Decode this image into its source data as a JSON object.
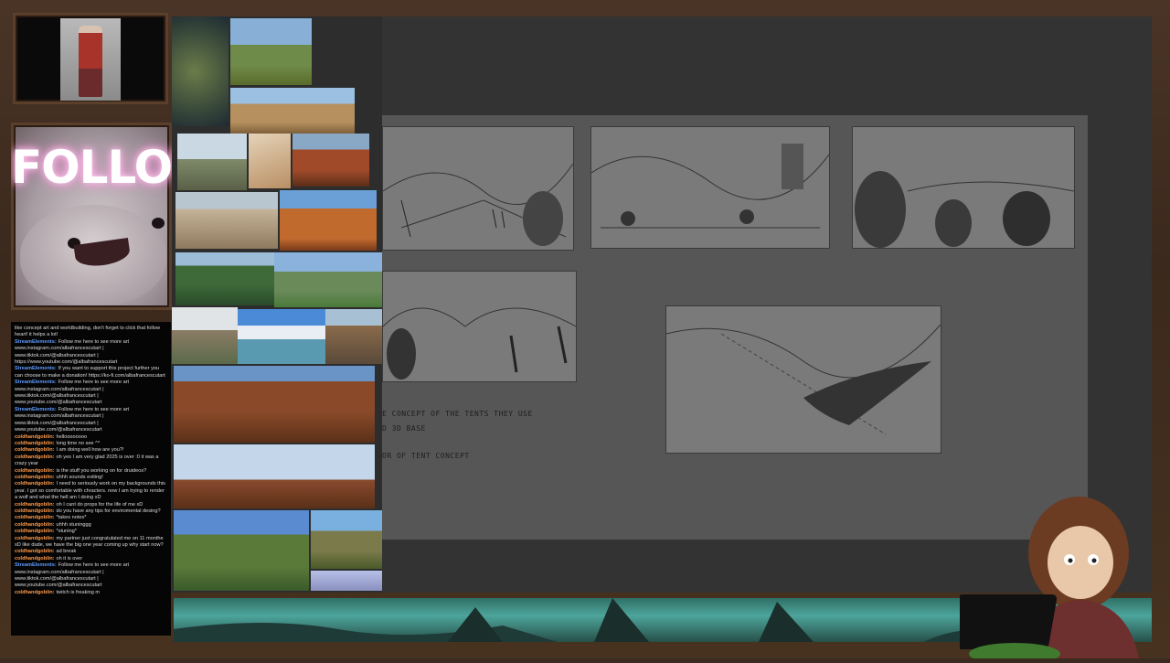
{
  "follow_panel": {
    "text": "FOLLOW"
  },
  "chat": {
    "messages": [
      {
        "user": "",
        "text": "like concept art and worldbuilding, don't forget to click that follow heart! it helps a lot!",
        "type": "cont"
      },
      {
        "user": "StreamElements:",
        "text": "Follow me here to see more art www.instagram.com/albafrancescutart | www.tiktok.com/@albafrancescutart | https://www.youtube.com/@albafrancescutart",
        "type": "se"
      },
      {
        "user": "StreamElements:",
        "text": "If you want to support this project further you can choose to make a donation! https://ko-fi.com/albafrancescutart",
        "type": "se"
      },
      {
        "user": "StreamElements:",
        "text": "Follow me here to see more art www.instagram.com/albafrancescutart | www.tiktok.com/@albafrancescutart | www.youtube.com/@albafrancescutart",
        "type": "se"
      },
      {
        "user": "StreamElements:",
        "text": "Follow me here to see more art www.instagram.com/albafrancescutart | www.tiktok.com/@albafrancescutart | www.youtube.com/@albafrancescutart",
        "type": "se"
      },
      {
        "user": "coldhandgoblin:",
        "text": "helloooooooo",
        "type": "ch"
      },
      {
        "user": "coldhandgoblin:",
        "text": "long time no see ^^",
        "type": "ch"
      },
      {
        "user": "coldhandgoblin:",
        "text": "I am doing well how are you?!",
        "type": "ch"
      },
      {
        "user": "coldhandgoblin:",
        "text": "oh yes I am very glad 2025 is over :0 it was a crazy year",
        "type": "ch"
      },
      {
        "user": "coldhandgoblin:",
        "text": "is the stuff you working on for druideos?",
        "type": "ch"
      },
      {
        "user": "coldhandgoblin:",
        "text": "uhhh sounds exiting!",
        "type": "ch"
      },
      {
        "user": "coldhandgoblin:",
        "text": "I need to seriously work on my backgrounds this year. I got so comfortable with chracters. now I am trying to render a wolf and what the hell am I doing xD",
        "type": "ch"
      },
      {
        "user": "coldhandgoblin:",
        "text": "oh I cant do props for the life of me xD",
        "type": "ch"
      },
      {
        "user": "coldhandgoblin:",
        "text": "do you have any tips for enviromental desing?",
        "type": "ch"
      },
      {
        "user": "coldhandgoblin:",
        "text": "*takes notes*",
        "type": "ch"
      },
      {
        "user": "coldhandgoblin:",
        "text": "uhhh stuninggg",
        "type": "ch"
      },
      {
        "user": "coldhandgoblin:",
        "text": "*stuning*",
        "type": "ch"
      },
      {
        "user": "coldhandgoblin:",
        "text": "my partner just congratulated me on 11 monthe xD like dude, we have the big one year coming up why start now?",
        "type": "ch"
      },
      {
        "user": "coldhandgoblin:",
        "text": "ad break",
        "type": "ch"
      },
      {
        "user": "coldhandgoblin:",
        "text": "oh it is over",
        "type": "ch"
      },
      {
        "user": "StreamElements:",
        "text": "Follow me here to see more art www.instagram.com/albafrancescutart | www.tiktok.com/@albafrancescutart | www.youtube.com/@albafrancescutart",
        "type": "se"
      },
      {
        "user": "coldhandgoblin:",
        "text": "twitch is freaking m",
        "type": "ch"
      }
    ]
  },
  "canvas_notes": {
    "line1": "E CONCEPT OF THE TENTS THEY USE",
    "line2": "D 3D BASE",
    "line3": "OR OF TENT CONCEPT"
  },
  "colors": {
    "frame": "#3b291d",
    "canvas_bg": "#565656",
    "chat_bg": "#050505",
    "streamelements_name": "#5e9cff",
    "coldhandgoblin_name": "#ff9a4a"
  }
}
